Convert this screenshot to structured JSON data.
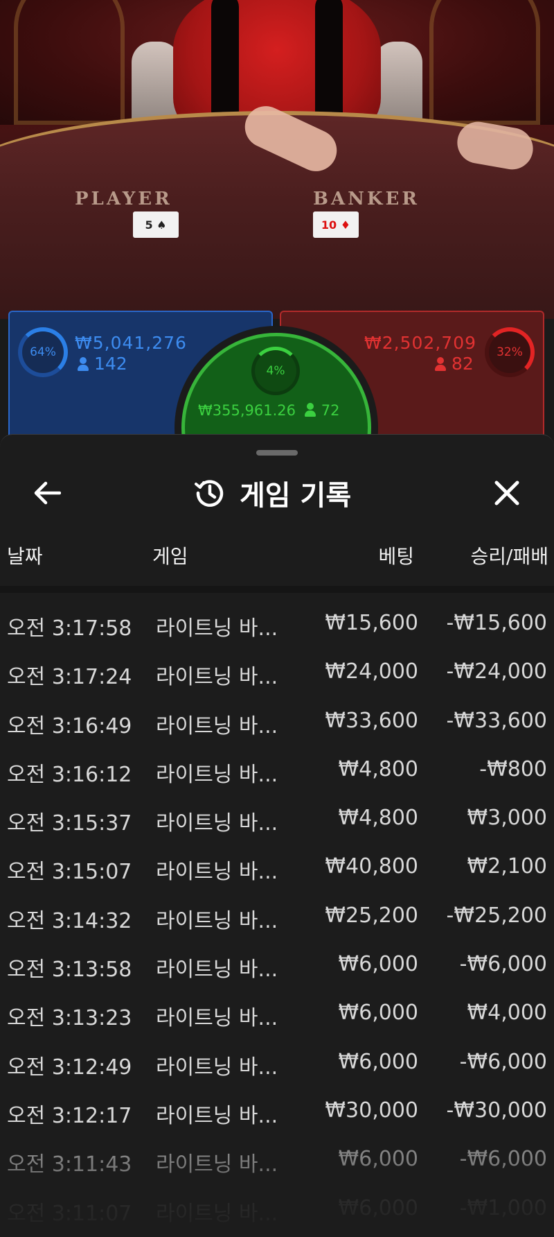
{
  "scene": {
    "labels": {
      "player": "PLAYER",
      "banker": "BANKER"
    },
    "cards": {
      "player": "5 ♠",
      "banker": "10 ♦"
    }
  },
  "bets": {
    "player": {
      "percent": "64%",
      "amount": "₩5,041,276",
      "count": "142",
      "color": "#3d8cf0"
    },
    "banker": {
      "percent": "32%",
      "amount": "₩2,502,709",
      "count": "82",
      "color": "#e23232"
    },
    "tie": {
      "percent": "4%",
      "amount": "₩355,961.26",
      "count": "72",
      "color": "#3bd040"
    }
  },
  "sheet": {
    "title": "게임 기록",
    "icons": {
      "back": "arrow-left-icon",
      "history": "history-icon",
      "close": "close-icon"
    },
    "columns": {
      "date": "날짜",
      "game": "게임",
      "bet": "베팅",
      "result": "승리/패배"
    },
    "rows": [
      {
        "date": "오전 3:17:58",
        "game": "라이트닝 바...",
        "bet": "₩15,600",
        "result": "-₩15,600"
      },
      {
        "date": "오전 3:17:24",
        "game": "라이트닝 바...",
        "bet": "₩24,000",
        "result": "-₩24,000"
      },
      {
        "date": "오전 3:16:49",
        "game": "라이트닝 바...",
        "bet": "₩33,600",
        "result": "-₩33,600"
      },
      {
        "date": "오전 3:16:12",
        "game": "라이트닝 바...",
        "bet": "₩4,800",
        "result": "-₩800"
      },
      {
        "date": "오전 3:15:37",
        "game": "라이트닝 바...",
        "bet": "₩4,800",
        "result": "₩3,000"
      },
      {
        "date": "오전 3:15:07",
        "game": "라이트닝 바...",
        "bet": "₩40,800",
        "result": "₩2,100"
      },
      {
        "date": "오전 3:14:32",
        "game": "라이트닝 바...",
        "bet": "₩25,200",
        "result": "-₩25,200"
      },
      {
        "date": "오전 3:13:58",
        "game": "라이트닝 바...",
        "bet": "₩6,000",
        "result": "-₩6,000"
      },
      {
        "date": "오전 3:13:23",
        "game": "라이트닝 바...",
        "bet": "₩6,000",
        "result": "₩4,000"
      },
      {
        "date": "오전 3:12:49",
        "game": "라이트닝 바...",
        "bet": "₩6,000",
        "result": "-₩6,000"
      },
      {
        "date": "오전 3:12:17",
        "game": "라이트닝 바...",
        "bet": "₩30,000",
        "result": "-₩30,000"
      },
      {
        "date": "오전 3:11:43",
        "game": "라이트닝 바...",
        "bet": "₩6,000",
        "result": "-₩6,000"
      },
      {
        "date": "오전 3:11:07",
        "game": "라이트닝 바...",
        "bet": "₩6,000",
        "result": "-₩1,000"
      }
    ]
  }
}
